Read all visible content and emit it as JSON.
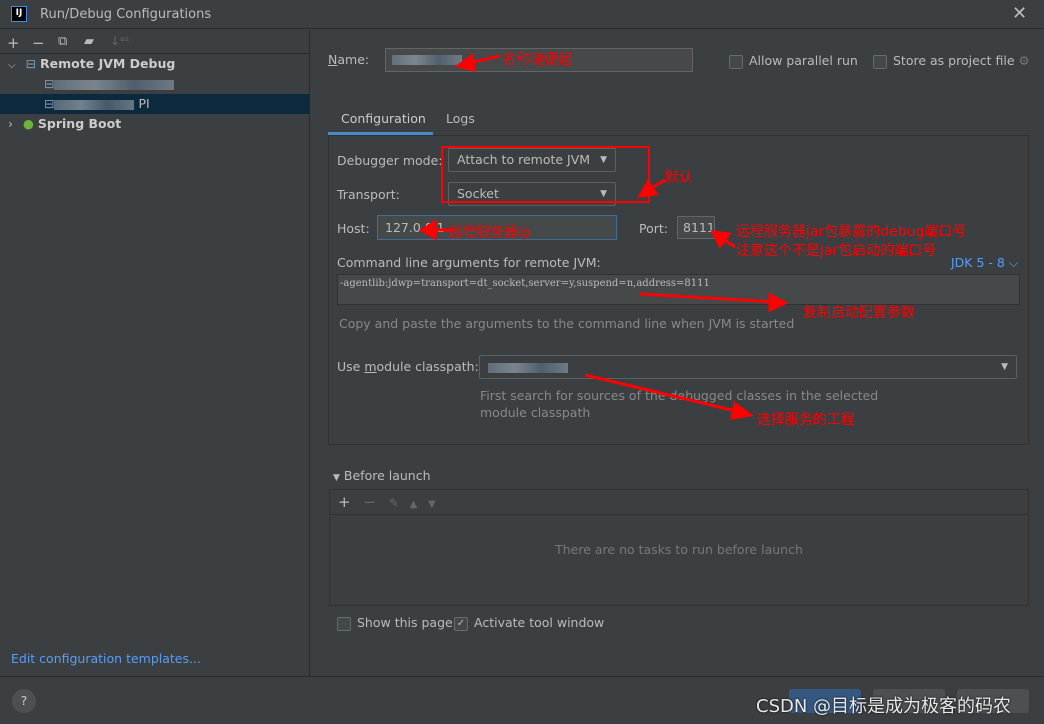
{
  "window": {
    "title": "Run/Debug Configurations",
    "logo": "IJ"
  },
  "toolbar": {
    "icons": [
      "add-icon",
      "remove-icon",
      "copy-icon",
      "folder-add-icon",
      "sort-icon"
    ]
  },
  "tree": {
    "groups": [
      {
        "label": "Remote JVM Debug",
        "children": [
          "",
          "PI"
        ]
      },
      {
        "label": "Spring Boot"
      }
    ]
  },
  "edit_templates": "Edit configuration templates...",
  "name": {
    "label": "Name:",
    "value": ""
  },
  "allow_parallel": {
    "label": "Allow parallel run",
    "checked": false
  },
  "store_project": {
    "label": "Store as project file",
    "checked": false
  },
  "tabs": [
    {
      "label": "Configuration",
      "active": true
    },
    {
      "label": "Logs"
    }
  ],
  "debugger_mode": {
    "label": "Debugger mode:",
    "value": "Attach to remote JVM"
  },
  "transport": {
    "label": "Transport:",
    "value": "Socket"
  },
  "host": {
    "label": "Host:",
    "value": "127.0.0.1"
  },
  "port": {
    "label": "Port:",
    "value": "8111"
  },
  "cmdline": {
    "label": "Command line arguments for remote JVM:",
    "jdk": "JDK 5 - 8",
    "value": "-agentlib:jdwp=transport=dt_socket,server=y,suspend=n,address=8111",
    "hint": "Copy and paste the arguments to the command line when JVM is started"
  },
  "module": {
    "label": "Use module classpath:",
    "hint1": "First search for sources of the debugged classes in the selected",
    "hint2": "module classpath"
  },
  "before_launch": {
    "label": "Before launch",
    "empty": "There are no tasks to run before launch"
  },
  "show_page": {
    "label": "Show this page",
    "checked": false
  },
  "activate_tool": {
    "label": "Activate tool window",
    "checked": true
  },
  "annotations": {
    "name": "名称随便起",
    "default": "默认",
    "host": "远程服务器ip",
    "port1": "远程服务器jar包暴露的debug端口号",
    "port2": "注意这个不是jar包启动的端口号",
    "args": "复制启动配置参数",
    "module": "选择服务的工程"
  },
  "watermark": "CSDN @目标是成为极客的码农",
  "colors": {
    "accent": "#4a88c7",
    "annotation": "#ff0000",
    "selection": "#0d293e"
  }
}
